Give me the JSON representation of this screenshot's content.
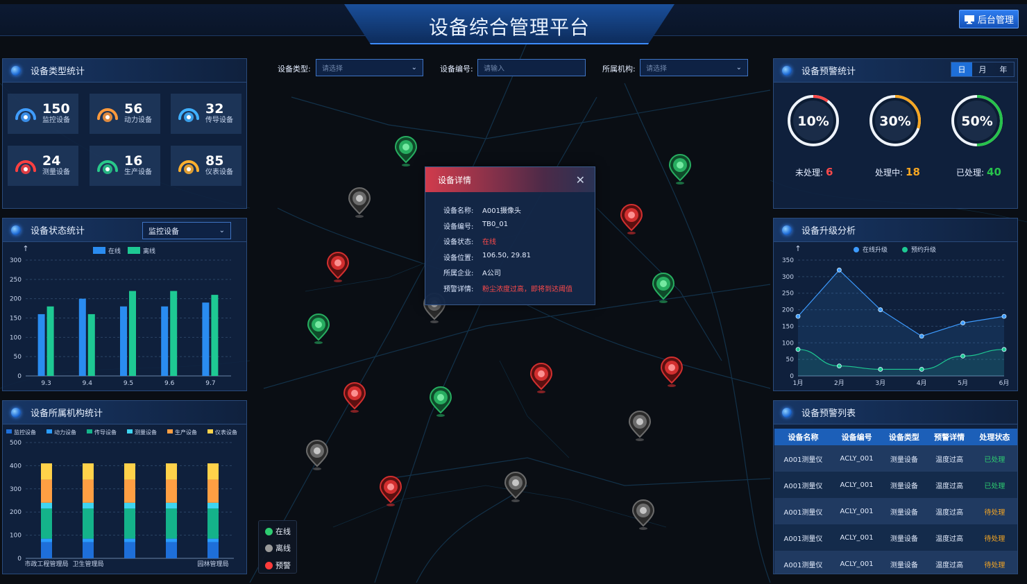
{
  "header": {
    "title": "设备综合管理平台",
    "admin_button": "后台管理"
  },
  "filters": {
    "type_label": "设备类型:",
    "type_placeholder": "请选择",
    "code_label": "设备编号:",
    "code_placeholder": "请输入",
    "org_label": "所属机构:",
    "org_placeholder": "请选择"
  },
  "device_types": {
    "title": "设备类型统计",
    "items": [
      {
        "count": "150",
        "label": "监控设备",
        "color": "#3f9dff",
        "icon": "monitor-icon"
      },
      {
        "count": "56",
        "label": "动力设备",
        "color": "#ff9a3c",
        "icon": "engine-icon"
      },
      {
        "count": "32",
        "label": "传导设备",
        "color": "#3fb0ff",
        "icon": "conduction-icon"
      },
      {
        "count": "24",
        "label": "测量设备",
        "color": "#ff4040",
        "icon": "measure-icon"
      },
      {
        "count": "16",
        "label": "生产设备",
        "color": "#29c98a",
        "icon": "production-icon"
      },
      {
        "count": "85",
        "label": "仪表设备",
        "color": "#ffb02e",
        "icon": "gauge-icon"
      }
    ]
  },
  "status_stats": {
    "title": "设备状态统计",
    "select": "监控设备",
    "chart_data": {
      "type": "bar",
      "categories": [
        "9.3",
        "9.4",
        "9.5",
        "9.6",
        "9.7"
      ],
      "series": [
        {
          "name": "在线",
          "values": [
            160,
            200,
            180,
            180,
            190
          ],
          "color": "#2a8cf0"
        },
        {
          "name": "离线",
          "values": [
            180,
            160,
            220,
            220,
            210
          ],
          "color": "#1ec993"
        }
      ],
      "ylim": [
        0,
        300
      ],
      "yticks": [
        0,
        50,
        100,
        150,
        200,
        250,
        300
      ],
      "grid": true,
      "legend": "top-center"
    }
  },
  "org_stats": {
    "title": "设备所属机构统计",
    "chart_data": {
      "type": "bar",
      "stacked": true,
      "categories": [
        "市政工程管理局",
        "卫生管理局",
        "",
        "",
        "园林管理局"
      ],
      "series": [
        {
          "name": "监控设备",
          "values": [
            70,
            70,
            70,
            70,
            70
          ],
          "color": "#1e6fd9"
        },
        {
          "name": "动力设备",
          "values": [
            15,
            15,
            15,
            15,
            15
          ],
          "color": "#2a9cff"
        },
        {
          "name": "传导设备",
          "values": [
            130,
            130,
            130,
            130,
            130
          ],
          "color": "#14b38a"
        },
        {
          "name": "测量设备",
          "values": [
            25,
            25,
            25,
            25,
            25
          ],
          "color": "#3fd4f0"
        },
        {
          "name": "生产设备",
          "values": [
            100,
            100,
            100,
            100,
            100
          ],
          "color": "#ff9f43"
        },
        {
          "name": "仪表设备",
          "values": [
            70,
            70,
            70,
            70,
            70
          ],
          "color": "#ffd24a"
        }
      ],
      "ylim": [
        0,
        500
      ],
      "yticks": [
        0,
        100,
        200,
        300,
        400,
        500
      ],
      "grid": true,
      "legend": "top"
    }
  },
  "alarm_stats": {
    "title": "设备预警统计",
    "tabs": [
      "日",
      "月",
      "年"
    ],
    "active_tab": 0,
    "gauges": [
      {
        "percent": "10%",
        "value": 10,
        "label": "未处理:",
        "count": "6",
        "color": "#ff4a4a"
      },
      {
        "percent": "30%",
        "value": 30,
        "label": "处理中:",
        "count": "18",
        "color": "#f5a623"
      },
      {
        "percent": "50%",
        "value": 50,
        "label": "已处理:",
        "count": "40",
        "color": "#27c24c"
      }
    ]
  },
  "upgrade": {
    "title": "设备升级分析",
    "chart_data": {
      "type": "line",
      "categories": [
        "1月",
        "2月",
        "3月",
        "4月",
        "5月",
        "6月"
      ],
      "series": [
        {
          "name": "在线升级",
          "values": [
            180,
            320,
            200,
            120,
            160,
            180
          ],
          "color": "#3d9bff"
        },
        {
          "name": "预约升级",
          "values": [
            80,
            30,
            20,
            20,
            60,
            80
          ],
          "color": "#1ec993"
        }
      ],
      "ylim": [
        0,
        350
      ],
      "yticks": [
        0,
        50,
        100,
        150,
        200,
        250,
        300,
        350
      ],
      "grid": true,
      "legend": "top-center"
    }
  },
  "alarm_list": {
    "title": "设备预警列表",
    "columns": [
      "设备名称",
      "设备编号",
      "设备类型",
      "预警详情",
      "处理状态"
    ],
    "rows": [
      {
        "name": "A001测量仪",
        "code": "ACLY_001",
        "type": "测量设备",
        "detail": "温度过高",
        "status": "已处理",
        "color": "#2ecc71"
      },
      {
        "name": "A001测量仪",
        "code": "ACLY_001",
        "type": "测量设备",
        "detail": "温度过高",
        "status": "已处理",
        "color": "#2ecc71"
      },
      {
        "name": "A001测量仪",
        "code": "ACLY_001",
        "type": "测量设备",
        "detail": "温度过高",
        "status": "待处理",
        "color": "#f5a623"
      },
      {
        "name": "A001测量仪",
        "code": "ACLY_001",
        "type": "测量设备",
        "detail": "温度过高",
        "status": "待处理",
        "color": "#f5a623"
      },
      {
        "name": "A001测量仪",
        "code": "ACLY_001",
        "type": "测量设备",
        "detail": "温度过高",
        "status": "待处理",
        "color": "#f5a623"
      }
    ]
  },
  "popup": {
    "title": "设备详情",
    "rows": [
      {
        "k": "设备名称:",
        "v": "A001摄像头",
        "color": "#e6eeff"
      },
      {
        "k": "设备编号:",
        "v": "TB0_01",
        "color": "#e6eeff"
      },
      {
        "k": "设备状态:",
        "v": "在线",
        "color": "#ff4a4a"
      },
      {
        "k": "设备位置:",
        "v": "106.50, 29.81",
        "color": "#e6eeff"
      },
      {
        "k": "所属企业:",
        "v": "A公司",
        "color": "#e6eeff"
      },
      {
        "k": "预警详情:",
        "v": "粉尘浓度过高，即将到达阈值",
        "color": "#ff4a4a"
      }
    ]
  },
  "map_legend": {
    "items": [
      {
        "label": "在线",
        "color": "#2ecc71"
      },
      {
        "label": "离线",
        "color": "#9a9a9a"
      },
      {
        "label": "预警",
        "color": "#ff3b3b"
      }
    ]
  },
  "map_pins": [
    {
      "status": "online"
    },
    {
      "status": "online"
    },
    {
      "status": "online"
    },
    {
      "status": "online"
    },
    {
      "status": "online"
    },
    {
      "status": "offline"
    },
    {
      "status": "offline"
    },
    {
      "status": "offline"
    },
    {
      "status": "offline"
    },
    {
      "status": "offline"
    },
    {
      "status": "offline"
    },
    {
      "status": "alarm"
    },
    {
      "status": "alarm"
    },
    {
      "status": "alarm"
    },
    {
      "status": "alarm"
    },
    {
      "status": "alarm"
    },
    {
      "status": "alarm"
    }
  ]
}
